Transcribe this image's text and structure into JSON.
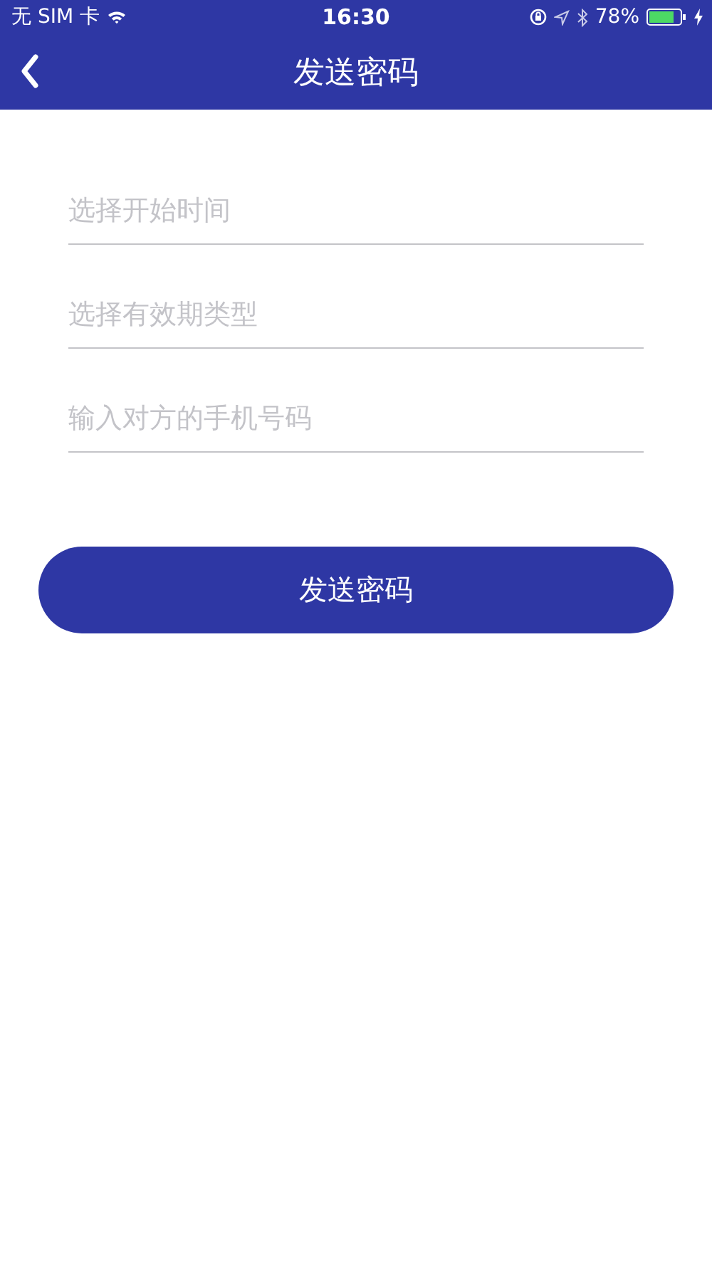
{
  "status_bar": {
    "carrier": "无 SIM 卡",
    "time": "16:30",
    "battery": "78%"
  },
  "nav_bar": {
    "title": "发送密码"
  },
  "fields": [
    {
      "placeholder": "选择开始时间"
    },
    {
      "placeholder": "选择有效期类型"
    },
    {
      "placeholder": "输入对方的手机号码"
    }
  ],
  "submit_button": {
    "label": "发送密码"
  }
}
